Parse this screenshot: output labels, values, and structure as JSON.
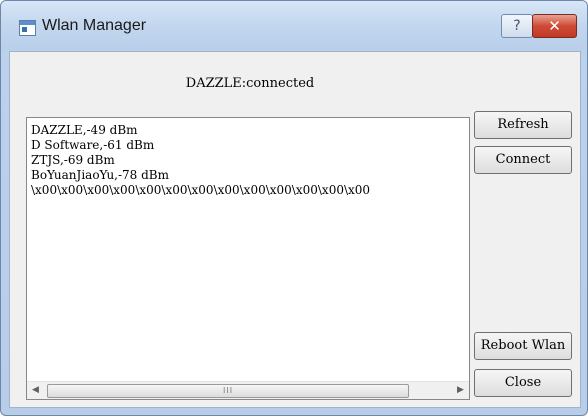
{
  "window": {
    "title": "Wlan Manager",
    "help_glyph": "?",
    "close_glyph": "✕"
  },
  "status_text": "DAZZLE:connected",
  "networks": [
    "DAZZLE,-49 dBm",
    "D Software,-61 dBm",
    "ZTJS,-69 dBm",
    "BoYuanJiaoYu,-78 dBm",
    "\\x00\\x00\\x00\\x00\\x00\\x00\\x00\\x00\\x00\\x00\\x00\\x00\\x00"
  ],
  "scrollbar": {
    "left_arrow": "◀",
    "right_arrow": "▶",
    "grip": "III"
  },
  "buttons": {
    "refresh": "Refresh",
    "connect": "Connect",
    "reboot": "Reboot Wlan",
    "close": "Close"
  },
  "colors": {
    "titlebar": "#bcd2ec",
    "close_button": "#cf4a36"
  }
}
